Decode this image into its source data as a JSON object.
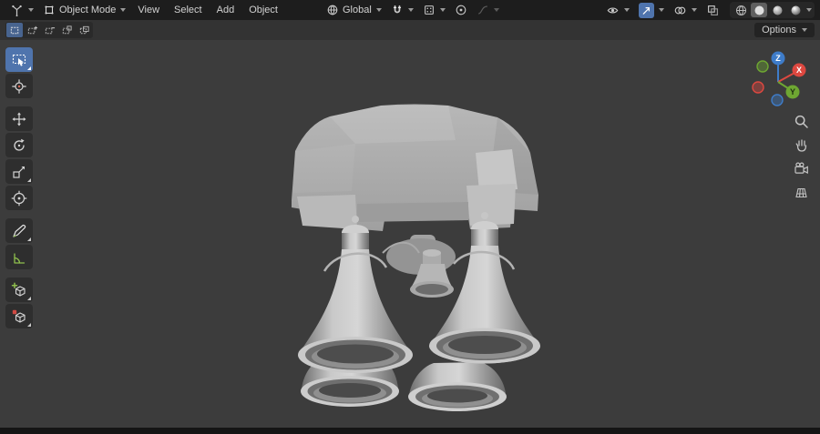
{
  "colors": {
    "accent": "#4f74ad",
    "axis_x": "#dd4840",
    "axis_y": "#6ea732",
    "axis_z": "#3e7cc9",
    "viewport_bg": "#3c3c3c",
    "topbar_bg": "#1d1d1d"
  },
  "topbar": {
    "mode_label": "Object Mode",
    "menus": [
      "View",
      "Select",
      "Add",
      "Object"
    ],
    "orientation_label": "Global"
  },
  "tool_settings": {
    "options_label": "Options"
  },
  "nav_gizmo": {
    "x_label": "X",
    "y_label": "Y",
    "z_label": "Z"
  },
  "icons": {
    "topbar_left": [
      "editor-type-icon",
      "object-mode-icon"
    ],
    "topbar_center": [
      "orientation-globe-icon",
      "snap-magnet-icon",
      "snap-increment-icon",
      "proportional-editing-icon",
      "falloff-curve-icon"
    ],
    "topbar_right": [
      "visibility-eye-icon",
      "show-gizmo-icon",
      "show-overlays-icon",
      "xray-icon",
      "shading-wireframe-icon",
      "shading-solid-icon",
      "shading-material-icon",
      "shading-rendered-icon"
    ],
    "toolbar": [
      "select-box-icon",
      "cursor-icon",
      "move-icon",
      "rotate-icon",
      "scale-icon",
      "transform-icon",
      "annotate-icon",
      "measure-icon",
      "add-cube-icon",
      "duplicate-icon"
    ],
    "viewport_right": [
      "zoom-icon",
      "pan-hand-icon",
      "camera-view-icon",
      "orthographic-grid-icon"
    ]
  }
}
